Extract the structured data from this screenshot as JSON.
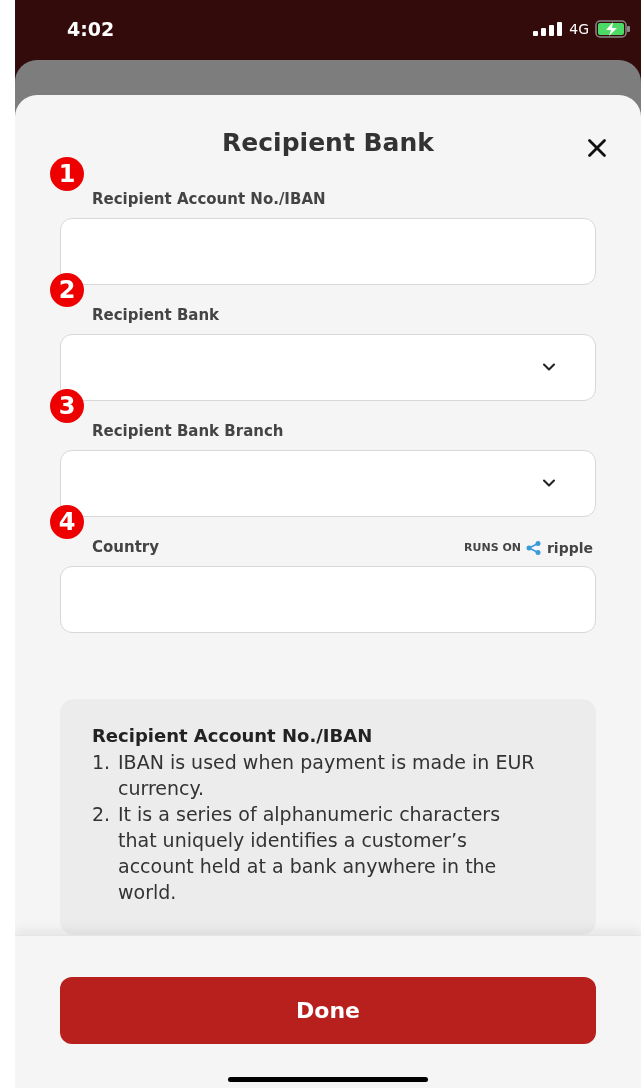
{
  "status_bar": {
    "time": "4:02",
    "network": "4G"
  },
  "sheet": {
    "title": "Recipient Bank"
  },
  "fields": [
    {
      "marker": "1",
      "label": "Recipient Account No./IBAN",
      "kind": "text"
    },
    {
      "marker": "2",
      "label": "Recipient Bank",
      "kind": "dropdown"
    },
    {
      "marker": "3",
      "label": "Recipient Bank Branch",
      "kind": "dropdown"
    },
    {
      "marker": "4",
      "label": "Country",
      "kind": "text",
      "note": "RUNS ON",
      "brand": "ripple"
    }
  ],
  "help": {
    "title": "Recipient Account No./IBAN",
    "items": [
      {
        "number": "1.",
        "text": "IBAN is used when payment is made in EUR currency."
      },
      {
        "number": "2.",
        "text": "It is a series of alphanumeric characters that uniquely identifies a customer’s account held at a bank anywhere in the world."
      }
    ]
  },
  "done_button": "Done"
}
